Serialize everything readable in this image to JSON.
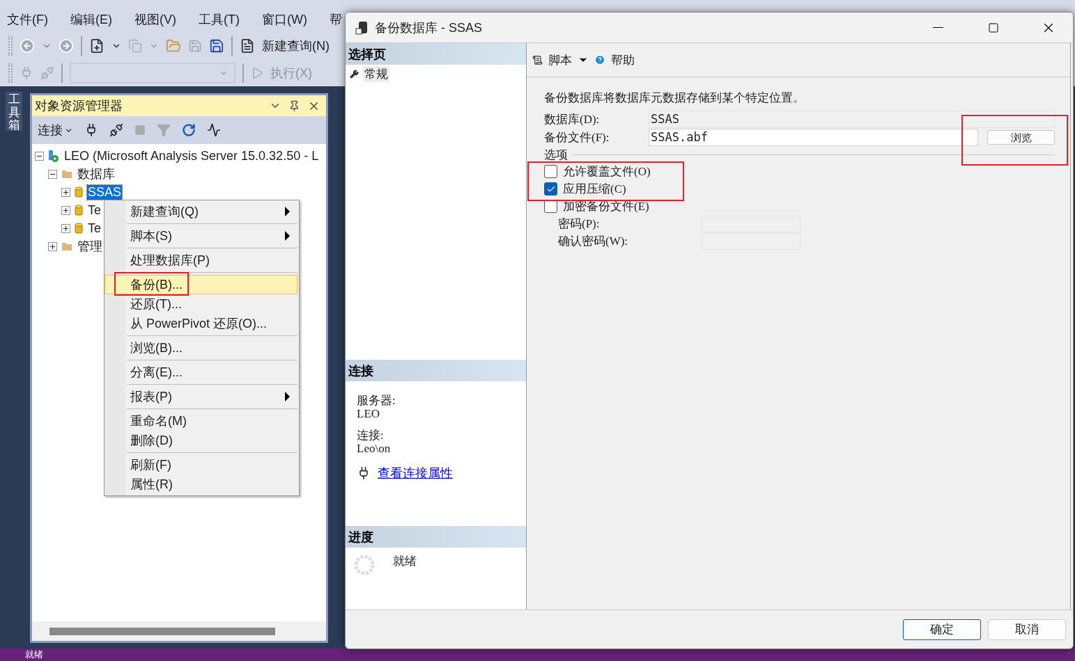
{
  "menu_bar": [
    {
      "label": "文件(F)"
    },
    {
      "label": "编辑(E)"
    },
    {
      "label": "视图(V)"
    },
    {
      "label": "工具(T)"
    },
    {
      "label": "窗口(W)"
    },
    {
      "label": "帮"
    }
  ],
  "toolbar": {
    "new_query": "新建查询(N)",
    "execute": "执行(X)"
  },
  "toolbox_tab": "工具箱",
  "object_explorer": {
    "title": "对象资源管理器",
    "connect": "连接",
    "tree": [
      {
        "kind": "server",
        "label": "LEO (Microsoft Analysis Server 15.0.32.50 - L",
        "expanded": true,
        "selected": false,
        "children": [
          {
            "kind": "folder",
            "label": "数据库",
            "expanded": true,
            "selected": false,
            "children": [
              {
                "kind": "database",
                "label": "SSAS",
                "expanded": false,
                "selected": true
              },
              {
                "kind": "database",
                "label": "Te",
                "expanded": false,
                "selected": false
              },
              {
                "kind": "database",
                "label": "Te",
                "expanded": false,
                "selected": false
              }
            ]
          },
          {
            "kind": "folder",
            "label": "管理",
            "expanded": false,
            "selected": false
          }
        ]
      }
    ]
  },
  "context_menu": [
    [
      {
        "label": "新建查询(Q)",
        "submenu": true,
        "selected": false
      }
    ],
    [
      {
        "label": "脚本(S)",
        "submenu": true,
        "selected": false
      }
    ],
    [
      {
        "label": "处理数据库(P)",
        "submenu": false,
        "selected": false
      }
    ],
    [
      {
        "label": "备份(B)...",
        "submenu": false,
        "selected": true
      },
      {
        "label": "还原(T)...",
        "submenu": false,
        "selected": false
      },
      {
        "label": "从 PowerPivot 还原(O)...",
        "submenu": false,
        "selected": false
      }
    ],
    [
      {
        "label": "浏览(B)...",
        "submenu": false,
        "selected": false
      }
    ],
    [
      {
        "label": "分离(E)...",
        "submenu": false,
        "selected": false
      }
    ],
    [
      {
        "label": "报表(P)",
        "submenu": true,
        "selected": false
      }
    ],
    [
      {
        "label": "重命名(M)",
        "submenu": false,
        "selected": false
      },
      {
        "label": "删除(D)",
        "submenu": false,
        "selected": false
      }
    ],
    [
      {
        "label": "刷新(F)",
        "submenu": false,
        "selected": false
      },
      {
        "label": "属性(R)",
        "submenu": false,
        "selected": false
      }
    ]
  ],
  "dialog": {
    "title": "备份数据库 - SSAS",
    "pages_header": "选择页",
    "pages": [
      {
        "label": "常规",
        "selected": true
      }
    ],
    "connection": {
      "header": "连接",
      "server_label": "服务器:",
      "server": "LEO",
      "connection_label": "连接:",
      "connection": "Leo\\on",
      "link": "查看连接属性"
    },
    "progress": {
      "header": "进度",
      "status": "就绪"
    },
    "toolbar": {
      "script": "脚本",
      "help": "帮助"
    },
    "description": "备份数据库将数据库元数据存储到某个特定位置。",
    "fields": [
      {
        "kind": "readonly",
        "label": "数据库(D):",
        "value": "SSAS"
      },
      {
        "kind": "file",
        "label": "备份文件(F):",
        "value": "SSAS.abf",
        "button": "浏览"
      }
    ],
    "options_title": "选项",
    "options": [
      {
        "label": "允许覆盖文件(O)",
        "checked": false
      },
      {
        "label": "应用压缩(C)",
        "checked": true
      },
      {
        "label": "加密备份文件(E)",
        "checked": false
      }
    ],
    "password_fields": [
      {
        "label": "密码(P):"
      },
      {
        "label": "确认密码(W):"
      }
    ],
    "buttons": [
      {
        "label": "确定",
        "default": true
      },
      {
        "label": "取消",
        "default": false
      }
    ]
  },
  "status_bar": {
    "text": "就绪"
  }
}
